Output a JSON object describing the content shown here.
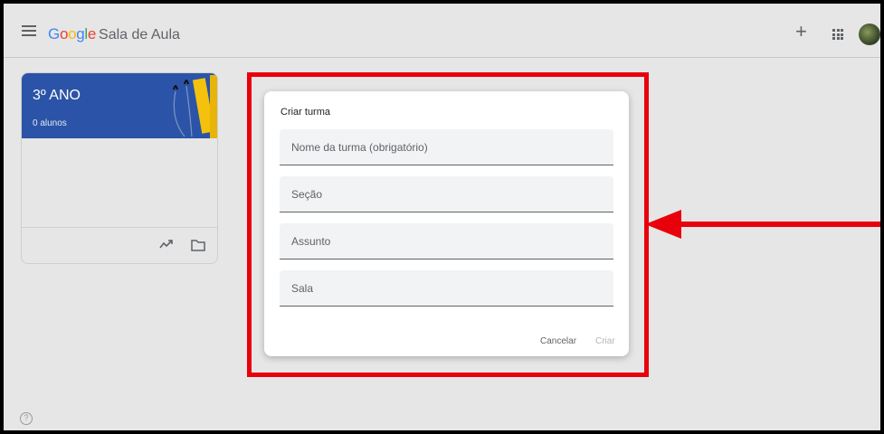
{
  "app": {
    "brand_letters": [
      "G",
      "o",
      "o",
      "g",
      "l",
      "e"
    ],
    "product": "Sala de Aula"
  },
  "header": {
    "plus_label": "+"
  },
  "class_card": {
    "title": "3º ANO",
    "students": "0 alunos"
  },
  "dialog": {
    "title": "Criar turma",
    "fields": {
      "name": "Nome da turma (obrigatório)",
      "section": "Seção",
      "subject": "Assunto",
      "room": "Sala"
    },
    "cancel_label": "Cancelar",
    "create_label": "Criar"
  },
  "help": {
    "label": "?"
  },
  "annotation": {
    "highlight_color": "#e8000b"
  },
  "icons": [
    "menu-icon",
    "plus-icon",
    "apps-grid-icon",
    "avatar",
    "trending-icon",
    "folder-icon",
    "help-icon",
    "arrow-icon"
  ]
}
